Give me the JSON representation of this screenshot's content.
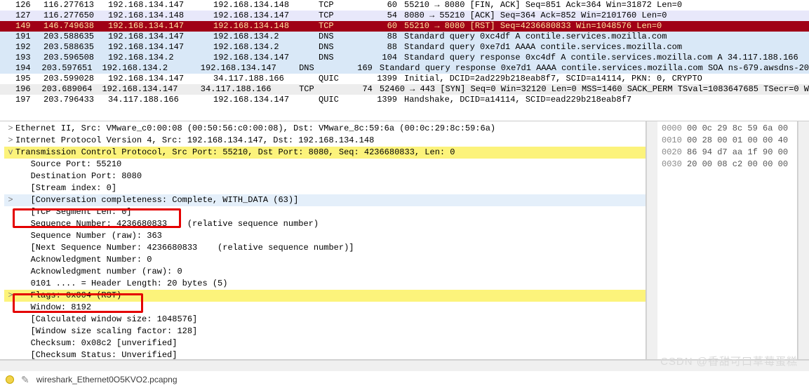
{
  "packets": [
    {
      "no": "126",
      "time": "116.277613",
      "src": "192.168.134.147",
      "dst": "192.168.134.148",
      "proto": "TCP",
      "len": "60",
      "info": "55210 → 8080 [FIN, ACK] Seq=851 Ack=364 Win=31872 Len=0",
      "cls": "row-light"
    },
    {
      "no": "127",
      "time": "116.277650",
      "src": "192.168.134.148",
      "dst": "192.168.134.147",
      "proto": "TCP",
      "len": "54",
      "info": "8080 → 55210 [ACK] Seq=364 Ack=852 Win=2101760 Len=0",
      "cls": "row-lavender"
    },
    {
      "no": "149",
      "time": "146.749638",
      "src": "192.168.134.147",
      "dst": "192.168.134.148",
      "proto": "TCP",
      "len": "60",
      "info": "55210 → 8080 [RST] Seq=4236680833 Win=1048576 Len=0",
      "cls": "row-darkred"
    },
    {
      "no": "191",
      "time": "203.588635",
      "src": "192.168.134.147",
      "dst": "192.168.134.2",
      "proto": "DNS",
      "len": "88",
      "info": "Standard query 0xc4df A contile.services.mozilla.com",
      "cls": "row-lightblue"
    },
    {
      "no": "192",
      "time": "203.588635",
      "src": "192.168.134.147",
      "dst": "192.168.134.2",
      "proto": "DNS",
      "len": "88",
      "info": "Standard query 0xe7d1 AAAA contile.services.mozilla.com",
      "cls": "row-lightblue"
    },
    {
      "no": "193",
      "time": "203.596508",
      "src": "192.168.134.2",
      "dst": "192.168.134.147",
      "proto": "DNS",
      "len": "104",
      "info": "Standard query response 0xc4df A contile.services.mozilla.com A 34.117.188.166",
      "cls": "row-lightblue"
    },
    {
      "no": "194",
      "time": "203.597651",
      "src": "192.168.134.2",
      "dst": "192.168.134.147",
      "proto": "DNS",
      "len": "169",
      "info": "Standard query response 0xe7d1 AAAA contile.services.mozilla.com SOA ns-679.awsdns-20",
      "cls": "row-lightblue"
    },
    {
      "no": "195",
      "time": "203.599028",
      "src": "192.168.134.147",
      "dst": "34.117.188.166",
      "proto": "QUIC",
      "len": "1399",
      "info": "Initial, DCID=2ad229b218eab8f7, SCID=a14114, PKN: 0, CRYPTO",
      "cls": "row-light"
    },
    {
      "no": "196",
      "time": "203.689064",
      "src": "192.168.134.147",
      "dst": "34.117.188.166",
      "proto": "TCP",
      "len": "74",
      "info": "52460 → 443 [SYN] Seq=0 Win=32120 Len=0 MSS=1460 SACK_PERM TSval=1083647685 TSecr=0 W",
      "cls": "row-gray"
    },
    {
      "no": "197",
      "time": "203.796433",
      "src": "34.117.188.166",
      "dst": "192.168.134.147",
      "proto": "QUIC",
      "len": "1399",
      "info": "Handshake, DCID=a14114, SCID=ead229b218eab8f7",
      "cls": "row-light"
    }
  ],
  "detail_lines": [
    {
      "caret": ">",
      "indent": 0,
      "text": "Ethernet II, Src: VMware_c0:00:08 (00:50:56:c0:00:08), Dst: VMware_8c:59:6a (00:0c:29:8c:59:6a)",
      "cls": ""
    },
    {
      "caret": ">",
      "indent": 0,
      "text": "Internet Protocol Version 4, Src: 192.168.134.147, Dst: 192.168.134.148",
      "cls": ""
    },
    {
      "caret": "v",
      "indent": 0,
      "text": "Transmission Control Protocol, Src Port: 55210, Dst Port: 8080, Seq: 4236680833, Len: 0",
      "cls": "hl-yellow"
    },
    {
      "caret": "",
      "indent": 1,
      "text": "Source Port: 55210",
      "cls": ""
    },
    {
      "caret": "",
      "indent": 1,
      "text": "Destination Port: 8080",
      "cls": ""
    },
    {
      "caret": "",
      "indent": 1,
      "text": "[Stream index: 0]",
      "cls": ""
    },
    {
      "caret": ">",
      "indent": 1,
      "text": "[Conversation completeness: Complete, WITH_DATA (63)]",
      "cls": "hl-blue"
    },
    {
      "caret": "",
      "indent": 1,
      "text": "[TCP Segment Len: 0]",
      "cls": ""
    },
    {
      "caret": "",
      "indent": 1,
      "text": "Sequence Number: 4236680833    (relative sequence number)",
      "cls": ""
    },
    {
      "caret": "",
      "indent": 1,
      "text": "Sequence Number (raw): 363",
      "cls": ""
    },
    {
      "caret": "",
      "indent": 1,
      "text": "[Next Sequence Number: 4236680833    (relative sequence number)]",
      "cls": ""
    },
    {
      "caret": "",
      "indent": 1,
      "text": "Acknowledgment Number: 0",
      "cls": ""
    },
    {
      "caret": "",
      "indent": 1,
      "text": "Acknowledgment number (raw): 0",
      "cls": ""
    },
    {
      "caret": "",
      "indent": 1,
      "text": "0101 .... = Header Length: 20 bytes (5)",
      "cls": ""
    },
    {
      "caret": ">",
      "indent": 1,
      "text": "Flags: 0x004 (RST)",
      "cls": "hl-yellow"
    },
    {
      "caret": "",
      "indent": 1,
      "text": "Window: 8192",
      "cls": ""
    },
    {
      "caret": "",
      "indent": 1,
      "text": "[Calculated window size: 1048576]",
      "cls": ""
    },
    {
      "caret": "",
      "indent": 1,
      "text": "[Window size scaling factor: 128]",
      "cls": ""
    },
    {
      "caret": "",
      "indent": 1,
      "text": "Checksum: 0x08c2 [unverified]",
      "cls": ""
    },
    {
      "caret": "",
      "indent": 1,
      "text": "[Checksum Status: Unverified]",
      "cls": ""
    }
  ],
  "hex": [
    {
      "off": "0000",
      "bytes": "00 0c 29 8c 59 6a 00"
    },
    {
      "off": "0010",
      "bytes": "00 28 00 01 00 00 40"
    },
    {
      "off": "0020",
      "bytes": "86 94 d7 aa 1f 90 00"
    },
    {
      "off": "0030",
      "bytes": "20 00 08 c2 00 00 00"
    }
  ],
  "status": {
    "file": "wireshark_Ethernet0O5KVO2.pcapng"
  },
  "watermark": "CSDN @香甜可口草莓蛋糕"
}
